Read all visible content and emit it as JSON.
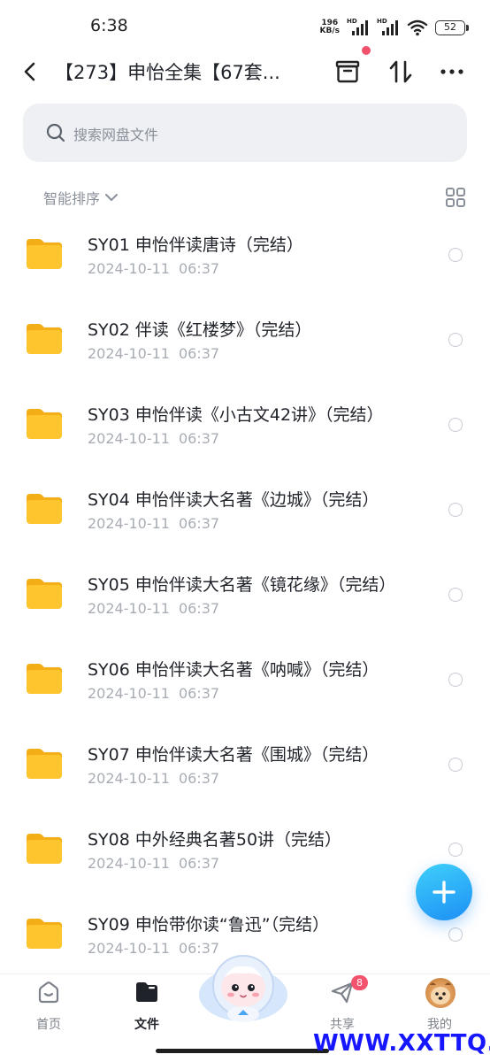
{
  "status_bar": {
    "time": "6:38",
    "net_speed_value": "196",
    "net_speed_unit": "KB/s",
    "sim1_label": "HD",
    "sim2_label": "HD",
    "battery": "52"
  },
  "header": {
    "title": "【273】申怡全集【67套...",
    "back_icon": "chevron-left-icon",
    "archive_icon": "archive-box-icon",
    "sort_icon": "transfer-arrows-icon",
    "more_icon": "more-horizontal-icon"
  },
  "search": {
    "placeholder": "搜索网盘文件"
  },
  "sort": {
    "label": "智能排序"
  },
  "files": [
    {
      "name": "SY01 申怡伴读唐诗（完结）",
      "date": "2024-10-11",
      "time": "06:37"
    },
    {
      "name": "SY02 伴读《红楼梦》（完结）",
      "date": "2024-10-11",
      "time": "06:37"
    },
    {
      "name": "SY03 申怡伴读《小古文42讲》（完结）",
      "date": "2024-10-11",
      "time": "06:37"
    },
    {
      "name": "SY04 申怡伴读大名著《边城》（完结）",
      "date": "2024-10-11",
      "time": "06:37"
    },
    {
      "name": "SY05 申怡伴读大名著《镜花缘》（完结）",
      "date": "2024-10-11",
      "time": "06:37"
    },
    {
      "name": "SY06 申怡伴读大名著《呐喊》（完结）",
      "date": "2024-10-11",
      "time": "06:37"
    },
    {
      "name": "SY07 申怡伴读大名著《围城》（完结）",
      "date": "2024-10-11",
      "time": "06:37"
    },
    {
      "name": "SY08 中外经典名著50讲（完结）",
      "date": "2024-10-11",
      "time": "06:37"
    },
    {
      "name": "SY09 申怡带你读“鲁迅”（完结）",
      "date": "2024-10-11",
      "time": "06:37"
    }
  ],
  "nav": {
    "home": "首页",
    "files": "文件",
    "share": "共享",
    "share_badge": "8",
    "mine": "我的"
  },
  "watermark": "WWW.XXTTQ.COM",
  "colors": {
    "accent": "#1d8ff5",
    "folder": "#ffc52f",
    "badge": "#f3536c",
    "watermark": "#1717ff"
  }
}
